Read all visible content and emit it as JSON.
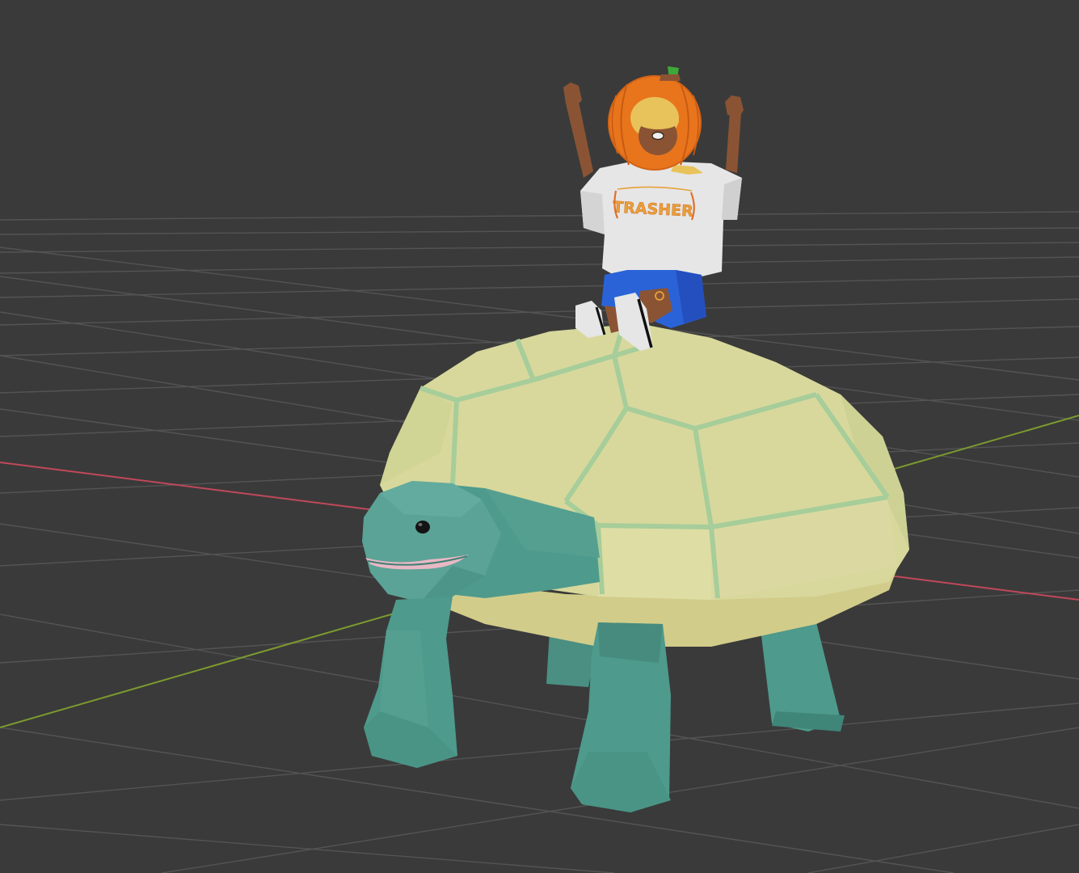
{
  "viewport": {
    "background": "#3a3a3a",
    "grid_color": "#545454",
    "x_axis_color": "#c0485a",
    "y_axis_color": "#7d9a2e"
  },
  "scene": {
    "character": {
      "shirt_text": "TRASHER",
      "shirt_color": "#e8e8e8",
      "shorts_color": "#2a63d8",
      "pumpkin_color": "#e8741c",
      "stem_color": "#3fa83a",
      "skin_color": "#8a5434",
      "hair_color": "#e8c25a"
    },
    "tortoise": {
      "shell_color": "#dcdca0",
      "shell_seam_color": "#a6cd9a",
      "body_color": "#4e9a8c",
      "mouth_color": "#e8b8c4"
    }
  }
}
